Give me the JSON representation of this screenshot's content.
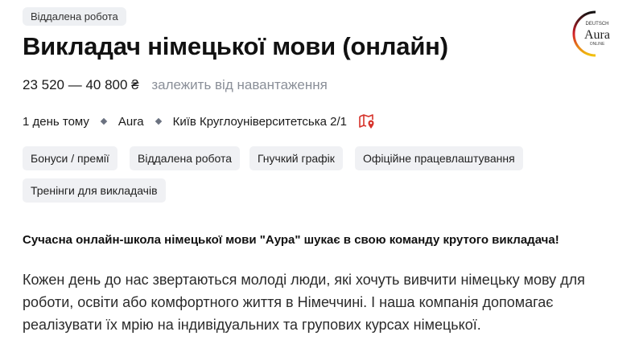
{
  "badge": "Віддалена робота",
  "logo": {
    "top_text": "DEUTSCH",
    "brand": "Aura",
    "bottom_text": "ONLINE"
  },
  "title": "Викладач німецької мови (онлайн)",
  "salary": {
    "range": "23 520 — 40 800 ₴",
    "note": "залежить від навантаження"
  },
  "meta": {
    "posted": "1 день тому",
    "company": "Aura",
    "location": "Київ Круглоуніверситетська 2/1",
    "map_icon": "map-pin-icon"
  },
  "chips": [
    "Бонуси / премії",
    "Віддалена робота",
    "Гнучкий графік",
    "Офіційне працевлаштування",
    "Тренінги для викладачів"
  ],
  "description": {
    "lead": "Сучасна онлайн-школа німецької мови \"Аура\" шукає в свою команду крутого викладача!",
    "paragraph_lines": [
      "Кожен день до нас звертаються молоді люди, які хочуть вивчити німецьку мову для",
      "роботи, освіти або комфортного життя в Німеччині. І наша компанія допомагає",
      "реалізувати їх мрію на індивідуальних та групових курсах німецької."
    ]
  },
  "colors": {
    "map_icon": "#d6332b",
    "chip_bg": "#f0f1f4",
    "muted_text": "#8a8f98"
  }
}
